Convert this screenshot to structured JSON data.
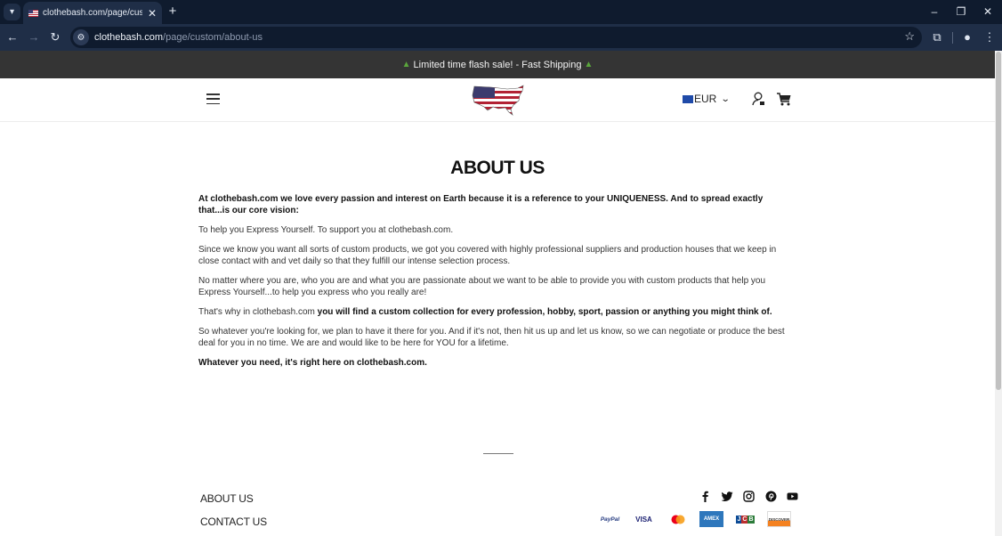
{
  "browser": {
    "tab": {
      "title": "clothebash.com/page/custom/about-us",
      "favicon": "us-flag-icon"
    },
    "url": {
      "host": "clothebash.com",
      "path": "/page/custom/about-us"
    },
    "icons": {
      "tab_search": "▾",
      "tab_close": "✕",
      "new_tab": "+",
      "minimize": "–",
      "restore": "❐",
      "close": "✕",
      "back": "←",
      "forward": "→",
      "reload": "↻",
      "site_info": "⚙",
      "bookmark": "☆",
      "extensions": "⧉",
      "profile": "●",
      "menu": "⋮"
    }
  },
  "announcement": {
    "text": "Limited time flash sale! - Fast Shipping",
    "icon": "▲"
  },
  "header": {
    "currency": {
      "code": "EUR",
      "chevron": "⌄"
    }
  },
  "main": {
    "title": "ABOUT US",
    "paragraphs": {
      "p1": "At clothebash.com we love every passion and interest on Earth because it is a reference to your UNIQUENESS. And to spread exactly that...is our core vision:",
      "p2": "To help you Express Yourself. To support you at clothebash.com.",
      "p3": "Since we know you want all sorts of custom products, we got you covered with highly professional suppliers and production houses that we keep in close contact with and vet daily so that they fulfill our intense selection process.",
      "p4": "No matter where you are, who you are and what you are passionate about we want to be able to provide you with custom products that help you Express Yourself...to help you express who you really are!",
      "p5_plain": "That's why in clothebash.com ",
      "p5_bold": "you will find a custom collection for every profession, hobby, sport, passion or anything you might think of.",
      "p6": "So whatever you're looking for, we plan to have it there for you. And if it's not, then hit us up and let us know, so we can negotiate or produce the best deal for you in no time. We are and would like to be here for YOU for a lifetime.",
      "p7": "Whatever you need, it's right here on clothebash.com."
    }
  },
  "footer": {
    "links": [
      "ABOUT US",
      "CONTACT US"
    ],
    "social": [
      "facebook",
      "twitter",
      "instagram",
      "pinterest",
      "youtube"
    ],
    "payments": {
      "paypal": "PayPal",
      "visa": "VISA",
      "amex": "AMEX",
      "jcb": "JCB",
      "discover": "DISCOVER"
    }
  },
  "colors": {
    "announcement_bg": "#343434",
    "browser_frame": "#0f1b2e",
    "browser_toolbar": "#1f2e47"
  }
}
